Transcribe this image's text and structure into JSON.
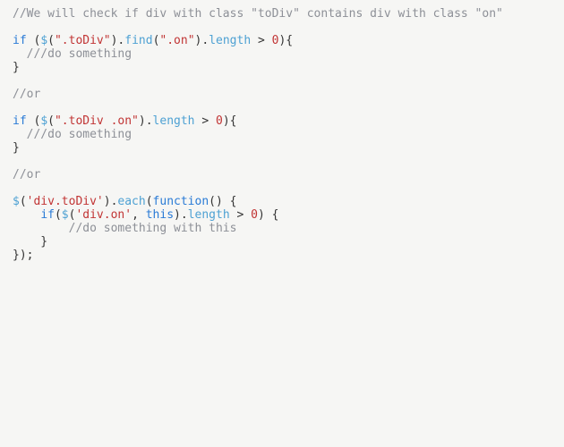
{
  "code": {
    "tokens": [
      {
        "t": "//We will check if div with class \"toDiv\" contains div with class \"on\"",
        "c": "c-comment"
      },
      {
        "t": "\n",
        "c": ""
      },
      {
        "t": "\n",
        "c": ""
      },
      {
        "t": "if",
        "c": "c-kw"
      },
      {
        "t": " (",
        "c": "c-punct"
      },
      {
        "t": "$",
        "c": "c-fn"
      },
      {
        "t": "(",
        "c": "c-punct"
      },
      {
        "t": "\".toDiv\"",
        "c": "c-str"
      },
      {
        "t": ").",
        "c": "c-punct"
      },
      {
        "t": "find",
        "c": "c-fn"
      },
      {
        "t": "(",
        "c": "c-punct"
      },
      {
        "t": "\".on\"",
        "c": "c-str"
      },
      {
        "t": ").",
        "c": "c-punct"
      },
      {
        "t": "length",
        "c": "c-fn"
      },
      {
        "t": " > ",
        "c": "c-punct"
      },
      {
        "t": "0",
        "c": "c-num"
      },
      {
        "t": "){",
        "c": "c-punct"
      },
      {
        "t": "\n",
        "c": ""
      },
      {
        "t": "  ",
        "c": ""
      },
      {
        "t": "///do something",
        "c": "c-comment"
      },
      {
        "t": "\n",
        "c": ""
      },
      {
        "t": "}",
        "c": "c-punct"
      },
      {
        "t": "\n",
        "c": ""
      },
      {
        "t": "\n",
        "c": ""
      },
      {
        "t": "//or",
        "c": "c-comment"
      },
      {
        "t": "\n",
        "c": ""
      },
      {
        "t": "\n",
        "c": ""
      },
      {
        "t": "if",
        "c": "c-kw"
      },
      {
        "t": " (",
        "c": "c-punct"
      },
      {
        "t": "$",
        "c": "c-fn"
      },
      {
        "t": "(",
        "c": "c-punct"
      },
      {
        "t": "\".toDiv .on\"",
        "c": "c-str"
      },
      {
        "t": ").",
        "c": "c-punct"
      },
      {
        "t": "length",
        "c": "c-fn"
      },
      {
        "t": " > ",
        "c": "c-punct"
      },
      {
        "t": "0",
        "c": "c-num"
      },
      {
        "t": "){",
        "c": "c-punct"
      },
      {
        "t": "\n",
        "c": ""
      },
      {
        "t": "  ",
        "c": ""
      },
      {
        "t": "///do something",
        "c": "c-comment"
      },
      {
        "t": "\n",
        "c": ""
      },
      {
        "t": "}",
        "c": "c-punct"
      },
      {
        "t": "\n",
        "c": ""
      },
      {
        "t": "\n",
        "c": ""
      },
      {
        "t": "//or",
        "c": "c-comment"
      },
      {
        "t": "\n",
        "c": ""
      },
      {
        "t": "\n",
        "c": ""
      },
      {
        "t": "$",
        "c": "c-fn"
      },
      {
        "t": "(",
        "c": "c-punct"
      },
      {
        "t": "'div.toDiv'",
        "c": "c-str"
      },
      {
        "t": ").",
        "c": "c-punct"
      },
      {
        "t": "each",
        "c": "c-fn"
      },
      {
        "t": "(",
        "c": "c-punct"
      },
      {
        "t": "function",
        "c": "c-kw"
      },
      {
        "t": "() {",
        "c": "c-punct"
      },
      {
        "t": "\n",
        "c": ""
      },
      {
        "t": "    ",
        "c": ""
      },
      {
        "t": "if",
        "c": "c-kw"
      },
      {
        "t": "(",
        "c": "c-punct"
      },
      {
        "t": "$",
        "c": "c-fn"
      },
      {
        "t": "(",
        "c": "c-punct"
      },
      {
        "t": "'div.on'",
        "c": "c-str"
      },
      {
        "t": ", ",
        "c": "c-punct"
      },
      {
        "t": "this",
        "c": "c-kw"
      },
      {
        "t": ").",
        "c": "c-punct"
      },
      {
        "t": "length",
        "c": "c-fn"
      },
      {
        "t": " > ",
        "c": "c-punct"
      },
      {
        "t": "0",
        "c": "c-num"
      },
      {
        "t": ") {",
        "c": "c-punct"
      },
      {
        "t": "\n",
        "c": ""
      },
      {
        "t": "        ",
        "c": ""
      },
      {
        "t": "//do something with this",
        "c": "c-comment"
      },
      {
        "t": "\n",
        "c": ""
      },
      {
        "t": "    }",
        "c": "c-punct"
      },
      {
        "t": "\n",
        "c": ""
      },
      {
        "t": "});",
        "c": "c-punct"
      },
      {
        "t": "\n",
        "c": ""
      }
    ]
  }
}
